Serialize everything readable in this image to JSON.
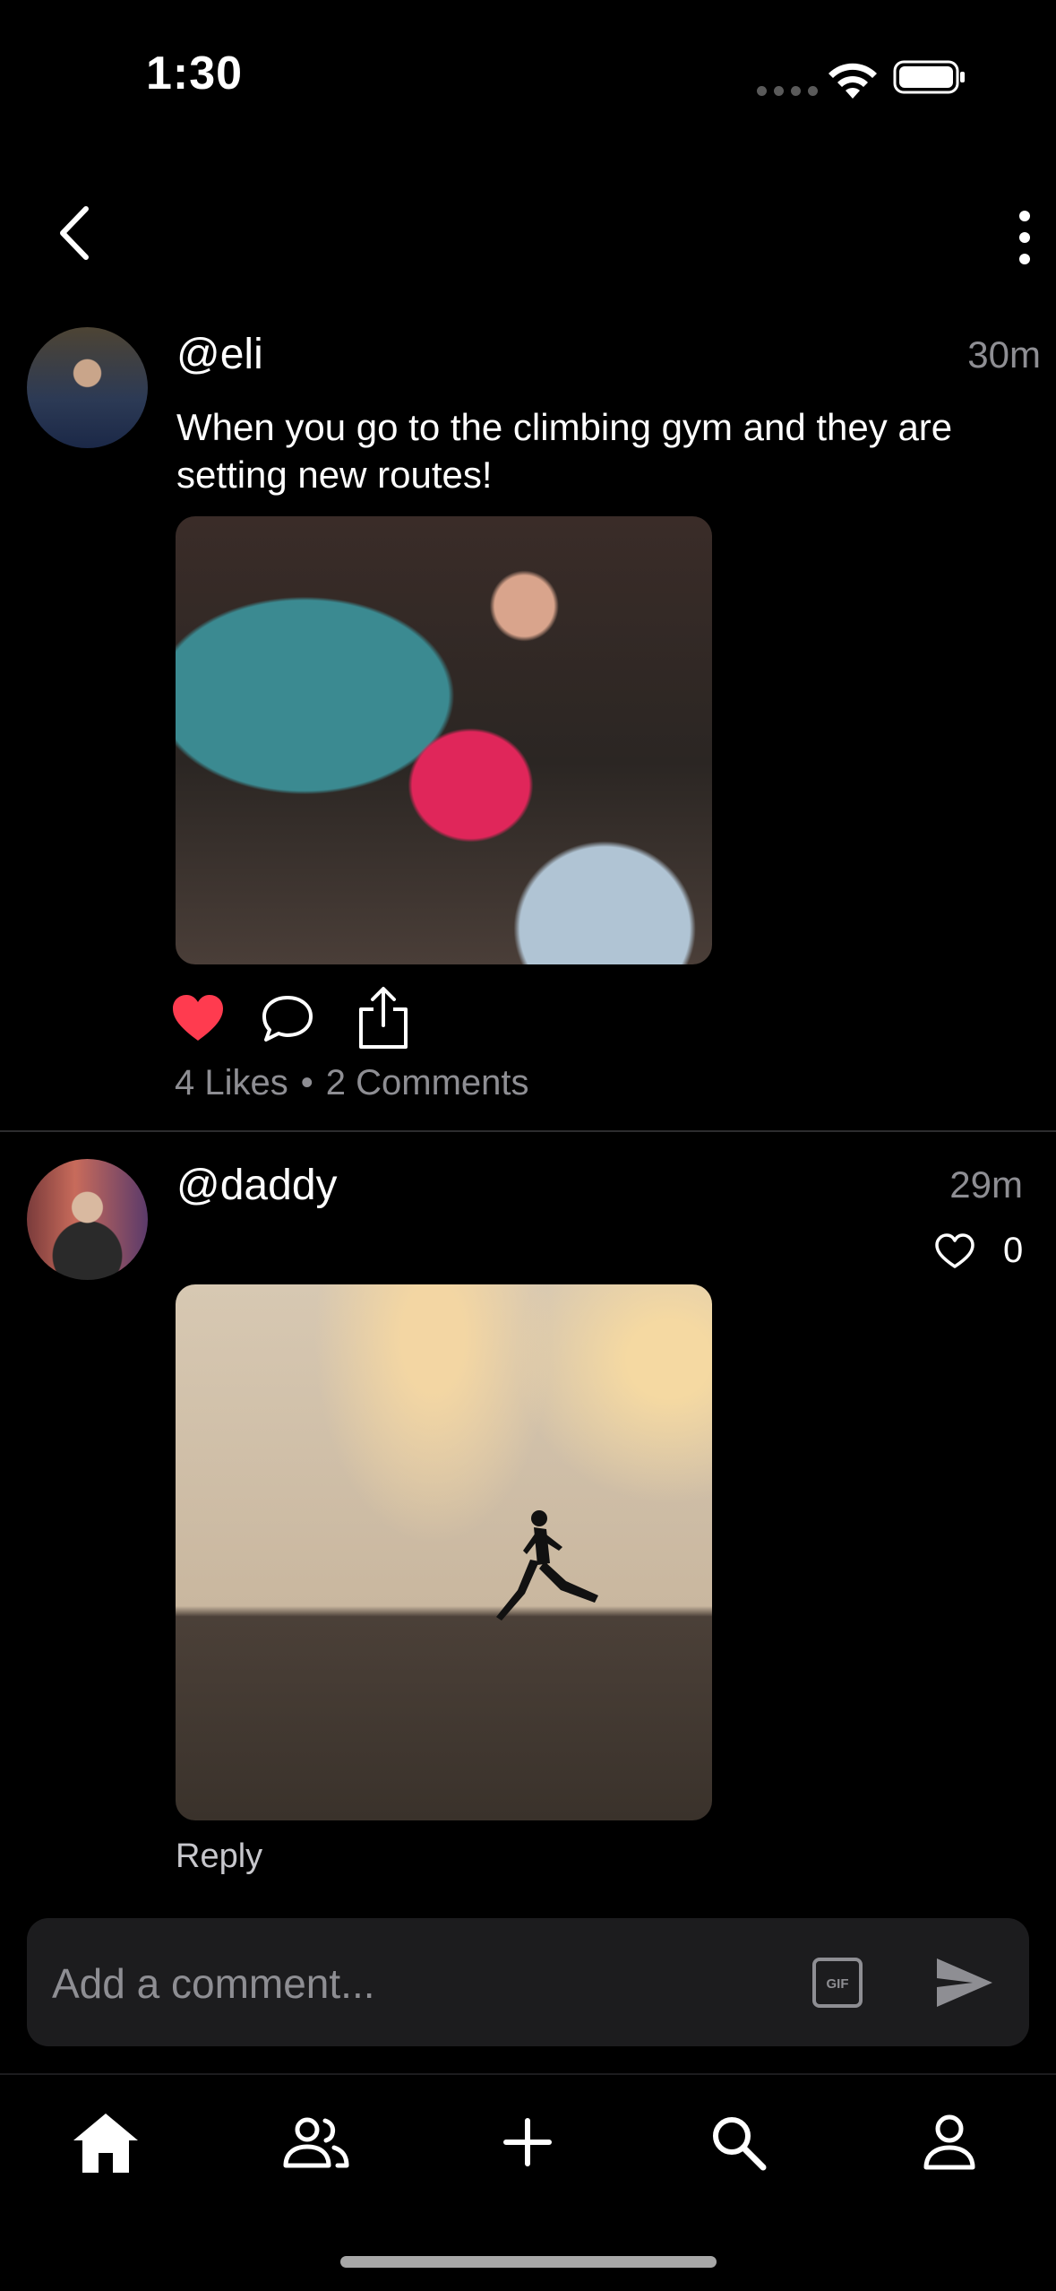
{
  "status_bar": {
    "time": "1:30"
  },
  "posts": [
    {
      "handle": "@eli",
      "time_ago": "30m",
      "text": "When you go to the climbing gym and they are setting new routes!",
      "liked": true,
      "stats": {
        "likes": "4 Likes",
        "separator": "•",
        "comments": "2 Comments"
      }
    },
    {
      "handle": "@daddy",
      "time_ago": "29m",
      "like_count": "0",
      "reply_label": "Reply"
    }
  ],
  "composer": {
    "placeholder": "Add a comment...",
    "gif_label": "GIF"
  },
  "colors": {
    "like_active": "#ff3b4f",
    "muted_text": "#8e8e93",
    "composer_bg": "#1c1c1e"
  },
  "icons": {
    "nav": [
      "back-chevron-icon",
      "more-vertical-icon"
    ],
    "actions": [
      "heart-filled-icon",
      "comment-bubble-icon",
      "share-icon"
    ],
    "tabs": [
      "home-icon",
      "friends-icon",
      "plus-icon",
      "search-icon",
      "profile-icon"
    ]
  }
}
